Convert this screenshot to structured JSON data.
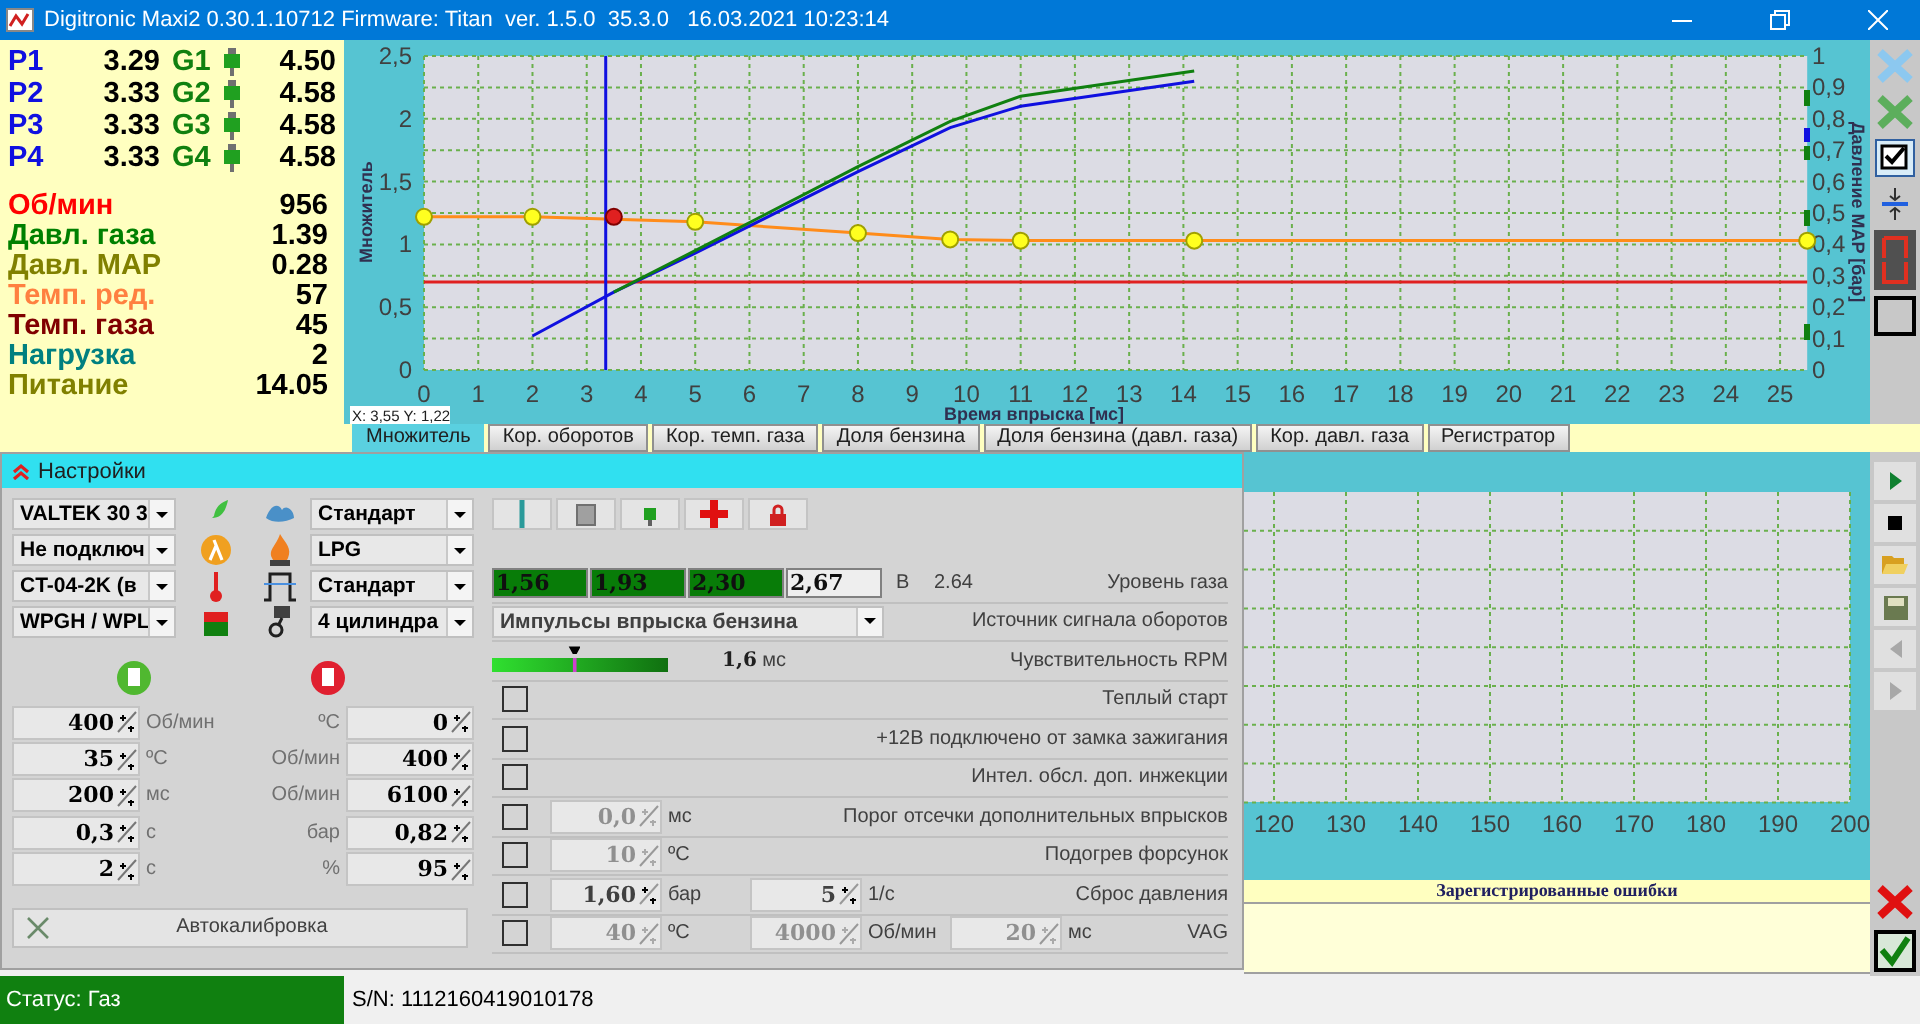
{
  "window": {
    "title": "Digitronic Maxi2 0.30.1.10712 Firmware: Titan  ver. 1.5.0  35.3.0   16.03.2021 10:23:14"
  },
  "injectors": [
    {
      "p_label": "P1",
      "p_value": "3.29",
      "g_label": "G1",
      "g_value": "4.50"
    },
    {
      "p_label": "P2",
      "p_value": "3.33",
      "g_label": "G2",
      "g_value": "4.58"
    },
    {
      "p_label": "P3",
      "p_value": "3.33",
      "g_label": "G3",
      "g_value": "4.58"
    },
    {
      "p_label": "P4",
      "p_value": "3.33",
      "g_label": "G4",
      "g_value": "4.58"
    }
  ],
  "readouts": [
    {
      "label": "Об/мин",
      "value": "956",
      "color": "#ff0000"
    },
    {
      "label": "Давл. газа",
      "value": "1.39",
      "color": "#008000"
    },
    {
      "label": "Давл. MAP",
      "value": "0.28",
      "color": "#808000"
    },
    {
      "label": "Темп. ред.",
      "value": "57",
      "color": "#ff8040"
    },
    {
      "label": "Темп. газа",
      "value": "45",
      "color": "#800000"
    },
    {
      "label": "Нагрузка",
      "value": "2",
      "color": "#008080"
    },
    {
      "label": "Питание",
      "value": "14.05",
      "color": "#808000"
    }
  ],
  "chart": {
    "cursor": "X: 3,55  Y: 1,22",
    "right_axis": {
      "label": "Давление MAP [бар]",
      "ticks": [
        "1",
        "0,9",
        "0,8",
        "0,7",
        "0,6",
        "0,5",
        "0,4",
        "0,3",
        "0,2",
        "0,1",
        "0"
      ]
    },
    "chart_data": {
      "type": "line",
      "grid": true,
      "xlabel": "Время впрыска [мс]",
      "ylabel": "Множитель",
      "xlim": [
        0,
        25.5
      ],
      "ylim": [
        0,
        2.5
      ],
      "xticks": [
        0,
        1,
        2,
        3,
        4,
        5,
        6,
        7,
        8,
        9,
        10,
        11,
        12,
        13,
        14,
        15,
        16,
        17,
        18,
        19,
        20,
        21,
        22,
        23,
        24,
        25
      ],
      "yticks": [
        {
          "value": 0,
          "label": "0"
        },
        {
          "value": 0.5,
          "label": "0,5"
        },
        {
          "value": 1,
          "label": "1"
        },
        {
          "value": 1.5,
          "label": "1,5"
        },
        {
          "value": 2,
          "label": "2"
        },
        {
          "value": 2.5,
          "label": "2,5"
        }
      ],
      "x": [
        0,
        2,
        3.5,
        5,
        8,
        9.7,
        11,
        14.2,
        25.5
      ],
      "series": [
        {
          "color": "#ff8c1a",
          "marker": "circle",
          "values": [
            1.22,
            1.22,
            null,
            1.18,
            1.09,
            1.04,
            1.03,
            1.03,
            1.03
          ]
        },
        {
          "color": "#e02020",
          "values": [
            0.7,
            0.7,
            0.7,
            0.7,
            0.7,
            0.7,
            0.7,
            0.7,
            0.7
          ]
        },
        {
          "color": "#1010e0",
          "values": [
            null,
            0.27,
            0.62,
            0.93,
            1.58,
            1.93,
            2.1,
            2.3,
            null
          ]
        },
        {
          "color": "#108010",
          "values": [
            null,
            null,
            0.62,
            0.95,
            1.62,
            1.98,
            2.18,
            2.38,
            null
          ]
        },
        {
          "color": "#e02020",
          "marker": "circle",
          "values": [
            null,
            null,
            1.22,
            null,
            null,
            null,
            null,
            null,
            null
          ]
        }
      ],
      "ref_lines": [
        {
          "axis": "x",
          "value": 3.35,
          "color": "#1010e0"
        }
      ]
    }
  },
  "tabs": [
    {
      "label": "Множитель",
      "selected": true
    },
    {
      "label": "Кор. оборотов",
      "selected": false
    },
    {
      "label": "Кор. темп. газа",
      "selected": false
    },
    {
      "label": "Доля бензина",
      "selected": false
    },
    {
      "label": "Доля бензина (давл. газа)",
      "selected": false
    },
    {
      "label": "Кор. давл. газа",
      "selected": false
    },
    {
      "label": "Регистратор",
      "selected": false
    }
  ],
  "settings": {
    "title": "Настройки",
    "selects_left": [
      "VALTEK 30 3",
      "Не подключ",
      "CT-04-2K (в",
      "WPGH / WPL"
    ],
    "selects_right": [
      "Стандарт",
      "LPG",
      "Стандарт",
      "4 цилиндра"
    ],
    "spins": [
      {
        "left_value": "400",
        "left_unit": "Об/мин",
        "right_unit": "ºС",
        "right_value": "0"
      },
      {
        "left_value": "35",
        "left_unit": "ºС",
        "right_unit": "Об/мин",
        "right_value": "400"
      },
      {
        "left_value": "200",
        "left_unit": "мс",
        "right_unit": "Об/мин",
        "right_value": "6100"
      },
      {
        "left_value": "0,3",
        "left_unit": "с",
        "right_unit": "бар",
        "right_value": "0,82"
      },
      {
        "left_value": "2",
        "left_unit": "с",
        "right_unit": "%",
        "right_value": "95"
      }
    ],
    "autocal": "Автокалибровка",
    "gas_levels": [
      {
        "value": "1,56",
        "on": true
      },
      {
        "value": "1,93",
        "on": true
      },
      {
        "value": "2,30",
        "on": true
      },
      {
        "value": "2,67",
        "on": false
      }
    ],
    "gas_unit": "В",
    "gas_reading": "2.64",
    "gas_label": "Уровень газа",
    "rpm_source": {
      "value": "Импульсы впрыска бензина",
      "label": "Источник сигнала оборотов"
    },
    "rpm_sens": {
      "level": 0.47,
      "value": "1,6",
      "unit": "мс",
      "label": "Чувствительность RPM"
    },
    "options": [
      {
        "checked": false,
        "label": "Теплый старт"
      },
      {
        "checked": false,
        "label": "+12В подключено от замка зажигания"
      },
      {
        "checked": false,
        "label": "Интел. обсл. доп. инжекции"
      },
      {
        "checked": false,
        "label": "Порог отсечки дополнительных впрысков",
        "fields": [
          {
            "value": "0,0",
            "unit": "мс",
            "disabled": true
          }
        ]
      },
      {
        "checked": false,
        "label": "Подогрев форсунок",
        "fields": [
          {
            "value": "10",
            "unit": "ºС",
            "disabled": true
          }
        ]
      },
      {
        "checked": false,
        "label": "Сброс давления",
        "fields": [
          {
            "value": "1,60",
            "unit": "бар",
            "disabled": false
          },
          {
            "value": "5",
            "unit": "1/с",
            "disabled": false
          }
        ]
      },
      {
        "checked": false,
        "label": "VAG",
        "fields": [
          {
            "value": "40",
            "unit": "ºС",
            "disabled": true
          },
          {
            "value": "4000",
            "unit": "Об/мин",
            "disabled": true
          },
          {
            "value": "20",
            "unit": "мс",
            "disabled": true
          }
        ]
      }
    ]
  },
  "logger": {
    "ticks": [
      "120",
      "130",
      "140",
      "150",
      "160",
      "170",
      "180",
      "190",
      "200"
    ]
  },
  "errors": {
    "title": "Зарегистрированные ошибки"
  },
  "status_bar": {
    "status": "Статус: Газ",
    "serial": "S/N: 1112160419010178"
  }
}
